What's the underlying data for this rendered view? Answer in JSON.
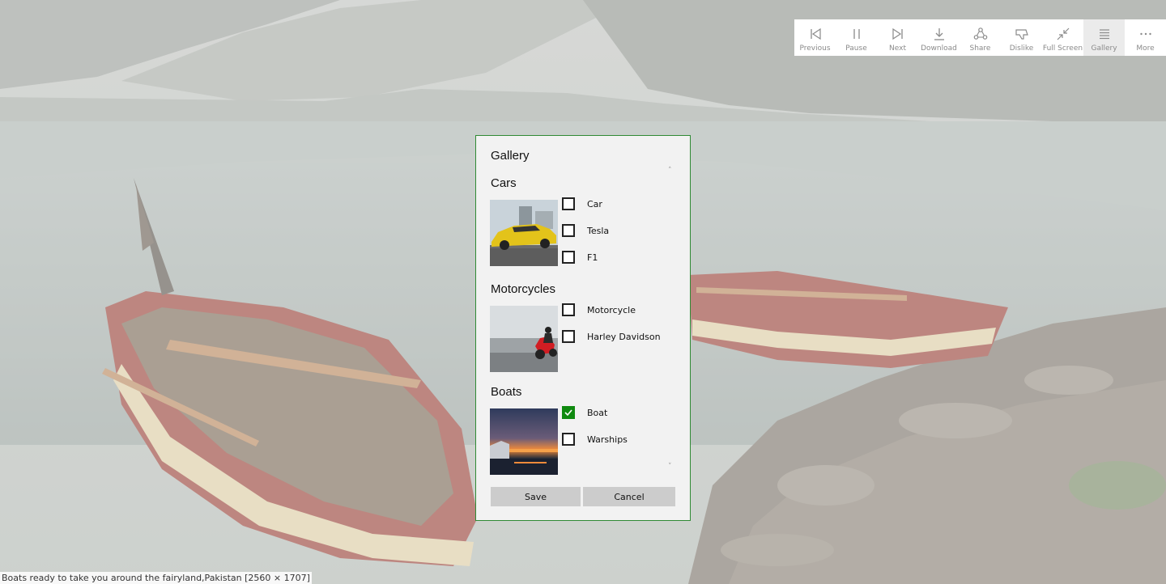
{
  "toolbar": {
    "buttons": [
      {
        "label": "Previous",
        "icon": "previous-icon"
      },
      {
        "label": "Pause",
        "icon": "pause-icon"
      },
      {
        "label": "Next",
        "icon": "next-icon"
      },
      {
        "label": "Download",
        "icon": "download-icon"
      },
      {
        "label": "Share",
        "icon": "share-icon"
      },
      {
        "label": "Dislike",
        "icon": "dislike-icon"
      },
      {
        "label": "Full Screen",
        "icon": "full-screen-icon"
      },
      {
        "label": "Gallery",
        "icon": "gallery-icon",
        "active": true
      },
      {
        "label": "More",
        "icon": "more-icon"
      }
    ]
  },
  "dialog": {
    "title": "Gallery",
    "sections": [
      {
        "title": "Cars",
        "thumbnail": "yellow-car-thumbnail",
        "options": [
          {
            "label": "Car",
            "checked": false
          },
          {
            "label": "Tesla",
            "checked": false
          },
          {
            "label": "F1",
            "checked": false
          }
        ]
      },
      {
        "title": "Motorcycles",
        "thumbnail": "red-motorcycle-thumbnail",
        "options": [
          {
            "label": "Motorcycle",
            "checked": false
          },
          {
            "label": "Harley Davidson",
            "checked": false
          }
        ]
      },
      {
        "title": "Boats",
        "thumbnail": "sunset-boat-thumbnail",
        "options": [
          {
            "label": "Boat",
            "checked": true
          },
          {
            "label": "Warships",
            "checked": false
          }
        ]
      }
    ],
    "scroll_up": "˄",
    "scroll_down": "˅",
    "save_label": "Save",
    "cancel_label": "Cancel"
  },
  "caption": "Boats ready to take you around the fairyland,Pakistan [2560 × 1707]",
  "colors": {
    "accent": "#108a10",
    "dialog_border": "#2f8a34",
    "dialog_bg": "#f2f2f2",
    "button_bg": "#cccccc",
    "toolbar_label": "#8a8a8a"
  }
}
